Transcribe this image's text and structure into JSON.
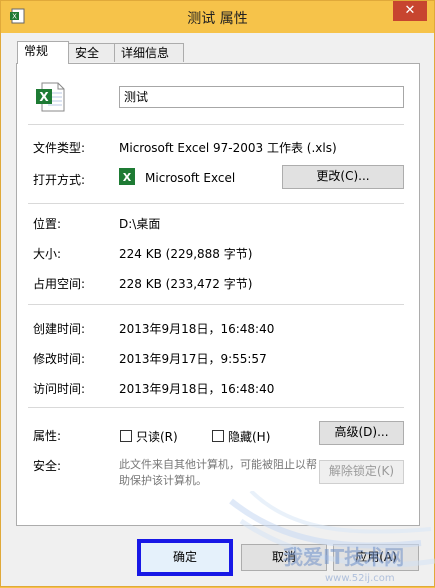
{
  "window": {
    "title": "测试 属性",
    "close_symbol": "✕"
  },
  "tabs": [
    {
      "label": "常规"
    },
    {
      "label": "安全"
    },
    {
      "label": "详细信息"
    }
  ],
  "general": {
    "file_name": "测试",
    "type_label": "文件类型:",
    "type_value": "Microsoft Excel 97-2003 工作表 (.xls)",
    "open_with_label": "打开方式:",
    "open_with_value": "Microsoft Excel",
    "change_button": "更改(C)...",
    "location_label": "位置:",
    "location_value": "D:\\桌面",
    "size_label": "大小:",
    "size_value": "224 KB (229,888 字节)",
    "size_on_disk_label": "占用空间:",
    "size_on_disk_value": "228 KB (233,472 字节)",
    "created_label": "创建时间:",
    "created_value": "2013年9月18日，16:48:40",
    "modified_label": "修改时间:",
    "modified_value": "2013年9月17日，9:55:57",
    "accessed_label": "访问时间:",
    "accessed_value": "2013年9月18日，16:48:40",
    "attributes_label": "属性:",
    "readonly_label": "只读(R)",
    "hidden_label": "隐藏(H)",
    "advanced_button": "高级(D)...",
    "security_label": "安全:",
    "security_text": "此文件来自其他计算机，可能被阻止以帮助保护该计算机。",
    "unblock_button": "解除锁定(K)"
  },
  "footer": {
    "ok_button": "确定",
    "cancel_button": "取消",
    "apply_button": "应用(A)"
  },
  "watermark": {
    "text": "我爱IT技术网",
    "sub": "www.52ij.com"
  },
  "colors": {
    "title_bar": "#f6c34a",
    "close_button": "#c7452f",
    "ok_highlight": "#1818e6",
    "excel_green": "#1e7b34"
  }
}
